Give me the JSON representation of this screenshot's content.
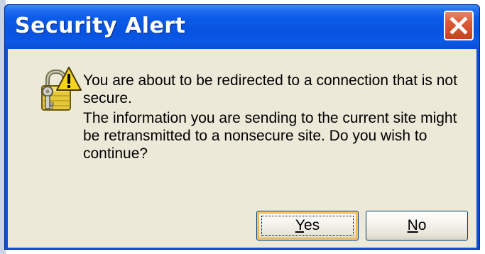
{
  "dialog": {
    "title": "Security Alert",
    "close_icon": "close-icon",
    "icon": "padlock-warning-icon",
    "message": {
      "line1": "You are about to be redirected to a connection that is not secure.",
      "line2": "The information you are sending to the current site might be retransmitted to a nonsecure site. Do you wish to continue?"
    },
    "buttons": {
      "yes": {
        "label_first": "Y",
        "label_rest": "es"
      },
      "no": {
        "label_first": "N",
        "label_rest": "o"
      }
    }
  },
  "colors": {
    "titlebar": "#0853e0",
    "client_background": "#ece9d8",
    "close_button": "#d85b34"
  }
}
